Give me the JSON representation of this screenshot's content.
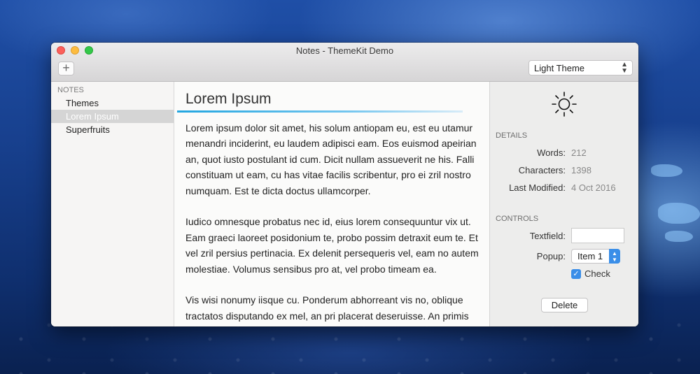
{
  "window": {
    "title": "Notes - ThemeKit Demo"
  },
  "toolbar": {
    "add_icon": "plus-icon",
    "add_glyph": "+",
    "theme_value": "Light Theme",
    "theme_chevron": "⌃⌄"
  },
  "sidebar": {
    "header": "NOTES",
    "items": [
      {
        "label": "Themes"
      },
      {
        "label": "Lorem Ipsum"
      },
      {
        "label": "Superfruits"
      }
    ],
    "selected_index": 1
  },
  "editor": {
    "title": "Lorem Ipsum",
    "paragraphs": [
      "Lorem ipsum dolor sit amet, his solum antiopam eu, est eu utamur menandri inciderint, eu laudem adipisci eam. Eos euismod apeirian an, quot iusto postulant id cum. Dicit nullam assueverit ne his. Falli constituam ut eam, cu has vitae facilis scribentur, pro ei zril nostro numquam. Est te dicta doctus ullamcorper.",
      "Iudico omnesque probatus nec id, eius lorem consequuntur vix ut. Eam graeci laoreet posidonium te, probo possim detraxit eum te. Et vel zril persius pertinacia. Ex delenit persequeris vel, eam no autem molestiae. Volumus sensibus pro at, vel probo timeam ea.",
      "Vis wisi nonumy iisque cu. Ponderum abhorreant vis no, oblique tractatos disputando ex mel, an pri placerat deseruisse. An primis"
    ]
  },
  "inspector": {
    "theme_icon": "sun-icon",
    "details_header": "DETAILS",
    "words_label": "Words:",
    "words_value": "212",
    "chars_label": "Characters:",
    "chars_value": "1398",
    "modified_label": "Last Modified:",
    "modified_value": "4 Oct 2016",
    "controls_header": "CONTROLS",
    "textfield_label": "Textfield:",
    "textfield_value": "",
    "popup_label": "Popup:",
    "popup_value": "Item 1",
    "check_label": "Check",
    "check_checked": true,
    "check_glyph": "✓",
    "delete_label": "Delete"
  },
  "colors": {
    "accent": "#3a8ee8",
    "title_rule": "#23a6e0"
  }
}
